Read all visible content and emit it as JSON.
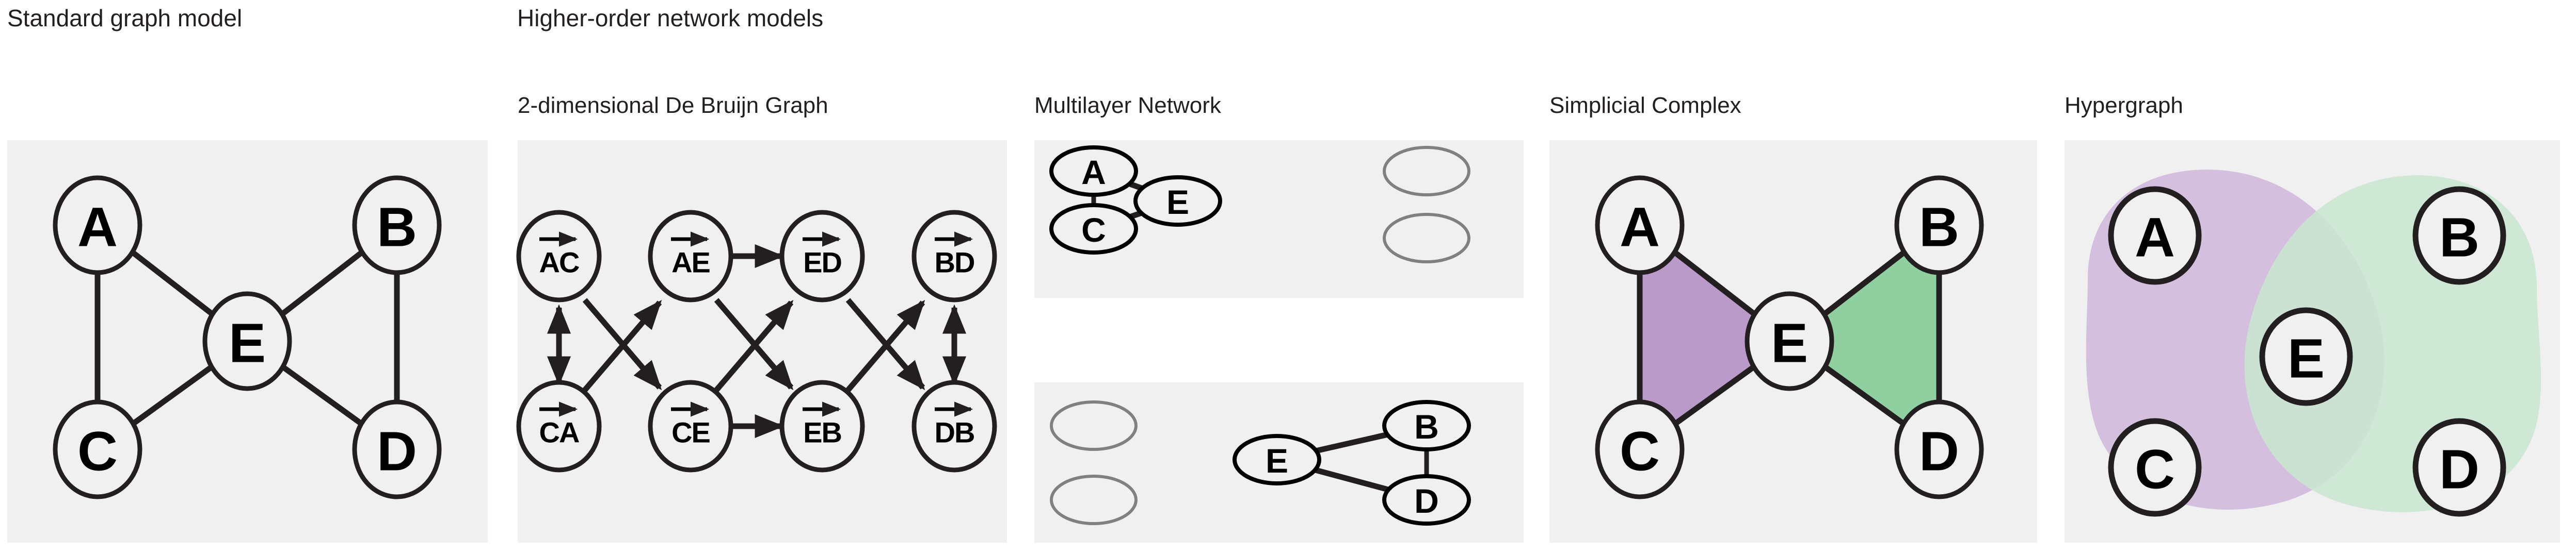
{
  "headers": {
    "standard": "Standard graph model",
    "higher_order": "Higher-order network models"
  },
  "colors": {
    "panel_background": "#f0f0f0",
    "page_background": "#ffffff",
    "ink": "#231f20",
    "node_fill": "#f0f0f0",
    "ghost_node_stroke": "#808080",
    "purple_fill": "#b99ac9",
    "green_fill": "#90cfa0",
    "hyper_purple": "#d4c0de",
    "hyper_green": "#cae5d0"
  },
  "panels": [
    {
      "id": "standard-graph",
      "title": "",
      "type": "graph",
      "nodes": [
        {
          "id": "A",
          "label": "A"
        },
        {
          "id": "B",
          "label": "B"
        },
        {
          "id": "C",
          "label": "C"
        },
        {
          "id": "D",
          "label": "D"
        },
        {
          "id": "E",
          "label": "E"
        }
      ],
      "edges": [
        {
          "from": "A",
          "to": "C"
        },
        {
          "from": "A",
          "to": "E"
        },
        {
          "from": "B",
          "to": "E"
        },
        {
          "from": "B",
          "to": "D"
        },
        {
          "from": "C",
          "to": "E"
        },
        {
          "from": "D",
          "to": "E"
        }
      ]
    },
    {
      "id": "de-bruijn",
      "title": "2-dimensional  De Bruijn Graph",
      "type": "directed-graph",
      "nodes": [
        {
          "id": "AC",
          "label": "AC"
        },
        {
          "id": "AE",
          "label": "AE"
        },
        {
          "id": "ED",
          "label": "ED"
        },
        {
          "id": "BD",
          "label": "BD"
        },
        {
          "id": "CA",
          "label": "CA"
        },
        {
          "id": "CE",
          "label": "CE"
        },
        {
          "id": "EB",
          "label": "EB"
        },
        {
          "id": "DB",
          "label": "DB"
        }
      ],
      "edges": [
        {
          "from": "AC",
          "to": "CA",
          "bidirectional": true
        },
        {
          "from": "AC",
          "to": "CE",
          "bidirectional": false
        },
        {
          "from": "CA",
          "to": "AE",
          "bidirectional": false
        },
        {
          "from": "AE",
          "to": "ED",
          "bidirectional": false
        },
        {
          "from": "AE",
          "to": "EB",
          "bidirectional": false
        },
        {
          "from": "CE",
          "to": "ED",
          "bidirectional": false
        },
        {
          "from": "CE",
          "to": "EB",
          "bidirectional": false
        },
        {
          "from": "ED",
          "to": "DB",
          "bidirectional": false
        },
        {
          "from": "EB",
          "to": "BD",
          "bidirectional": false
        },
        {
          "from": "DB",
          "to": "BD",
          "bidirectional": true
        }
      ]
    },
    {
      "id": "multilayer",
      "title": "Multilayer Network",
      "type": "multilayer",
      "layers": [
        {
          "name": "layer-1",
          "nodes": [
            {
              "id": "A",
              "label": "A",
              "ghost": false
            },
            {
              "id": "C",
              "label": "C",
              "ghost": false
            },
            {
              "id": "E",
              "label": "E",
              "ghost": false
            },
            {
              "id": "g1",
              "label": "",
              "ghost": true
            },
            {
              "id": "g2",
              "label": "",
              "ghost": true
            }
          ],
          "edges": [
            {
              "from": "A",
              "to": "C"
            },
            {
              "from": "A",
              "to": "E"
            },
            {
              "from": "C",
              "to": "E"
            }
          ]
        },
        {
          "name": "layer-2",
          "nodes": [
            {
              "id": "B",
              "label": "B",
              "ghost": false
            },
            {
              "id": "D",
              "label": "D",
              "ghost": false
            },
            {
              "id": "E",
              "label": "E",
              "ghost": false
            },
            {
              "id": "g3",
              "label": "",
              "ghost": true
            },
            {
              "id": "g4",
              "label": "",
              "ghost": true
            }
          ],
          "edges": [
            {
              "from": "E",
              "to": "B"
            },
            {
              "from": "E",
              "to": "D"
            },
            {
              "from": "B",
              "to": "D"
            }
          ]
        }
      ]
    },
    {
      "id": "simplicial-complex",
      "title": "Simplicial Complex",
      "type": "simplicial",
      "nodes": [
        {
          "id": "A",
          "label": "A"
        },
        {
          "id": "B",
          "label": "B"
        },
        {
          "id": "C",
          "label": "C"
        },
        {
          "id": "D",
          "label": "D"
        },
        {
          "id": "E",
          "label": "E"
        }
      ],
      "edges": [
        {
          "from": "A",
          "to": "C"
        },
        {
          "from": "A",
          "to": "E"
        },
        {
          "from": "C",
          "to": "E"
        },
        {
          "from": "B",
          "to": "E"
        },
        {
          "from": "B",
          "to": "D"
        },
        {
          "from": "D",
          "to": "E"
        }
      ],
      "triangles": [
        {
          "vertices": [
            "A",
            "C",
            "E"
          ],
          "color": "#b99ac9"
        },
        {
          "vertices": [
            "B",
            "D",
            "E"
          ],
          "color": "#90cfa0"
        }
      ]
    },
    {
      "id": "hypergraph",
      "title": "Hypergraph",
      "type": "hypergraph",
      "nodes": [
        {
          "id": "A",
          "label": "A"
        },
        {
          "id": "B",
          "label": "B"
        },
        {
          "id": "C",
          "label": "C"
        },
        {
          "id": "D",
          "label": "D"
        },
        {
          "id": "E",
          "label": "E"
        }
      ],
      "hyperedges": [
        {
          "members": [
            "A",
            "C",
            "E"
          ],
          "color": "#d4c0de"
        },
        {
          "members": [
            "B",
            "D",
            "E"
          ],
          "color": "#cae5d0"
        }
      ]
    }
  ],
  "chart_data": {
    "type": "diagram",
    "title": "Standard graph model vs. Higher-order network models",
    "base_network": {
      "nodes": [
        "A",
        "B",
        "C",
        "D",
        "E"
      ],
      "edges": [
        [
          "A",
          "C"
        ],
        [
          "A",
          "E"
        ],
        [
          "B",
          "E"
        ],
        [
          "B",
          "D"
        ],
        [
          "C",
          "E"
        ],
        [
          "D",
          "E"
        ]
      ]
    },
    "representations": [
      "Standard graph model",
      "2-dimensional  De Bruijn Graph",
      "Multilayer Network",
      "Simplicial Complex",
      "Hypergraph"
    ]
  }
}
